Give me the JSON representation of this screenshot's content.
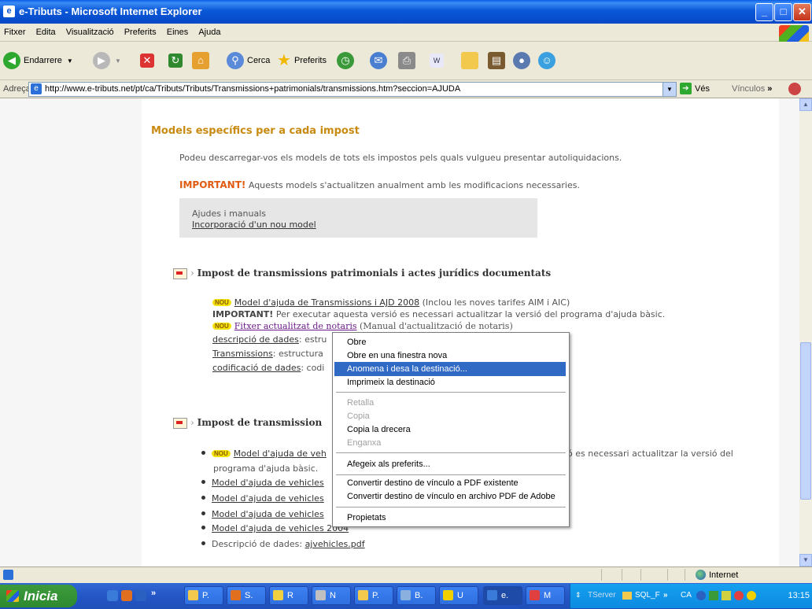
{
  "window": {
    "title": "e-Tributs - Microsoft Internet Explorer"
  },
  "menu": [
    "Fitxer",
    "Edita",
    "Visualització",
    "Preferits",
    "Eines",
    "Ajuda"
  ],
  "toolbar": {
    "back": "Endarrere",
    "search": "Cerca",
    "favorites": "Preferits"
  },
  "address": {
    "label": "Adreça",
    "url": "http://www.e-tributs.net/pt/ca/Tributs/Tributs/Transmissions+patrimonials/transmissions.htm?seccion=AJUDA",
    "go": "Vés",
    "links": "Vínculos"
  },
  "page": {
    "heading": "Models específics per a cada impost",
    "intro": "Podeu descarregar-vos els models de tots els impostos pels quals vulgueu presentar autoliquidacions.",
    "important_label": "IMPORTANT!",
    "important_text": " Aquests models s'actualitzen anualment amb les modificacions necessaries.",
    "box_title": "Ajudes i manuals",
    "box_link": "Incorporació d'un nou model",
    "section1": {
      "title": "Impost de transmissions patrimonials i actes jurídics documentats",
      "nou": "NOU",
      "model_link": "Model d'ajuda de Transmissions i AJD 2008",
      "model_note": " (Inclou les noves tarifes AIM i AIC)",
      "important_label": "IMPORTANT!",
      "important_text": " Per executar aquesta versió es necessari actualitzar la versió del programa d'ajuda bàsic.",
      "fitxer_link": "Fitxer actualitzat de notaris",
      "fitxer_note": " (Manual d'actualització de notaris)",
      "rows": [
        {
          "link": "descripció de dades",
          "text": ": estru"
        },
        {
          "link": "Transmissions",
          "text": ": estructura"
        },
        {
          "link": "codificació de dades",
          "text": ": codi"
        }
      ]
    },
    "section2": {
      "title": "Impost de transmission",
      "first_link": "Model d'ajuda de veh",
      "first_tail": "ió es necessari actualitzar la versió del",
      "first_line2": "programa d'ajuda bàsic.",
      "links": [
        "Model d'ajuda de vehicles",
        "Model d'ajuda de vehicles",
        "Model d'ajuda de vehicles",
        "Model d'ajuda de vehicles 2004"
      ],
      "desc_label": "Descripció de dades: ",
      "desc_link": "ajvehicles.pdf"
    }
  },
  "context_menu": [
    {
      "label": "Obre"
    },
    {
      "label": "Obre en una finestra nova"
    },
    {
      "label": "Anomena i desa la destinació..."
    },
    {
      "label": "Imprimeix la destinació"
    },
    {
      "label": "Retalla"
    },
    {
      "label": "Copia"
    },
    {
      "label": "Copia la drecera"
    },
    {
      "label": "Enganxa"
    },
    {
      "label": "Afegeix als preferits..."
    },
    {
      "label": "Convertir destino de vínculo a PDF existente"
    },
    {
      "label": "Convertir destino de vínculo en archivo PDF de Adobe"
    },
    {
      "label": "Propietats"
    }
  ],
  "status": {
    "zone": "Internet"
  },
  "taskbar": {
    "start": "Inicia",
    "tasks": [
      "P.",
      "S.",
      "R",
      "N",
      "P.",
      "B.",
      "U",
      "e.",
      "M"
    ],
    "tray": {
      "tserver": "TServer",
      "sql": "SQL_F",
      "lang": "CA",
      "clock": "13:15"
    }
  },
  "colors": {
    "accent": "#316ac5",
    "heading": "#c88a10",
    "important": "#e05a10"
  }
}
